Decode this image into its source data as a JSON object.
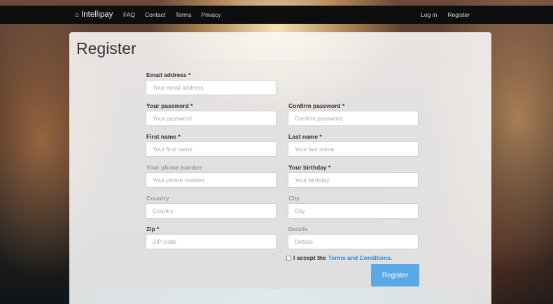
{
  "navbar": {
    "brand": "Intellipay",
    "brand_icon": "home-icon",
    "links": [
      "FAQ",
      "Contact",
      "Terms",
      "Privacy"
    ],
    "right_links": [
      "Log in",
      "Register"
    ]
  },
  "page": {
    "title": "Register"
  },
  "form": {
    "email": {
      "label": "Email address",
      "required": "*",
      "placeholder": "Your email address"
    },
    "password": {
      "label": "Your password",
      "required": "*",
      "placeholder": "Your password"
    },
    "confirm_password": {
      "label": "Confirm password",
      "required": "*",
      "placeholder": "Confirm password"
    },
    "first_name": {
      "label": "First name",
      "required": "*",
      "placeholder": "Your first name"
    },
    "last_name": {
      "label": "Last name",
      "required": "*",
      "placeholder": "Your last name"
    },
    "phone": {
      "label": "Your phone number",
      "placeholder": "Your phone number"
    },
    "birthday": {
      "label": "Your birthday",
      "required": "*",
      "placeholder": "Your birthday"
    },
    "country": {
      "label": "Country",
      "placeholder": "Country"
    },
    "city": {
      "label": "City",
      "placeholder": "City"
    },
    "zip": {
      "label": "Zip",
      "required": "*",
      "placeholder": "ZIP code"
    },
    "details": {
      "label": "Details",
      "placeholder": "Details"
    },
    "terms": {
      "text": "I accept the",
      "link": "Terms and Conditions",
      "suffix": "."
    },
    "submit": "Register"
  },
  "colors": {
    "accent": "#58a9e6",
    "link": "#2a8bd6",
    "navbar": "#0e0e0e"
  }
}
